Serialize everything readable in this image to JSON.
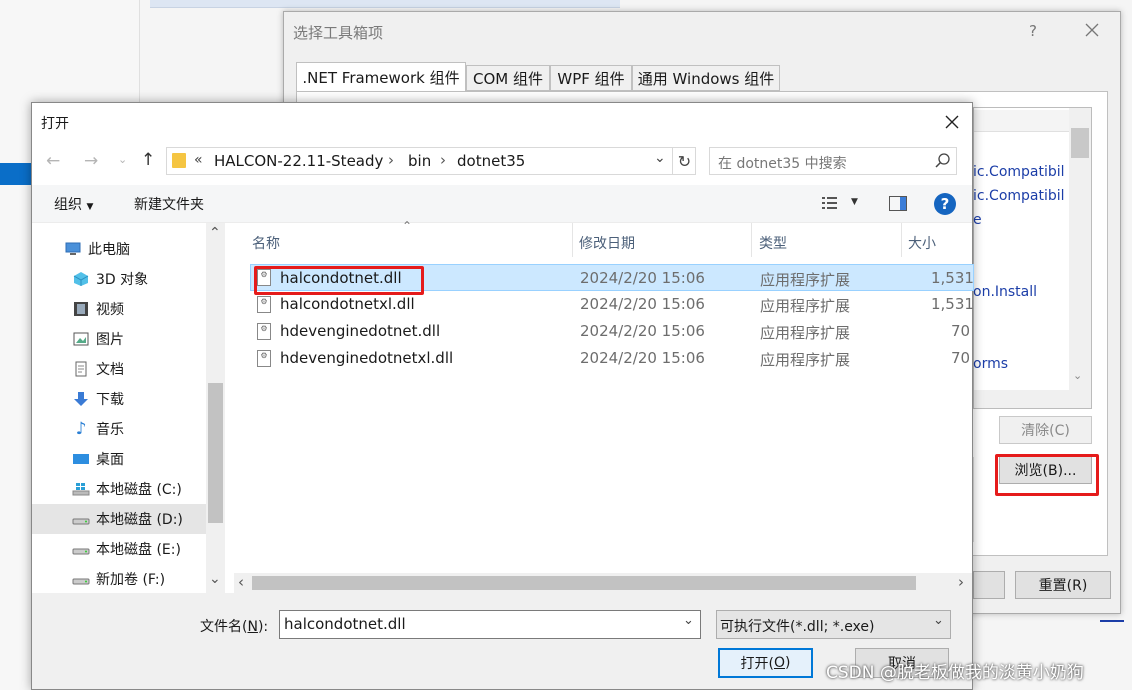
{
  "toolbox_dialog": {
    "title": "选择工具箱项",
    "help": "?",
    "tabs": [
      ".NET Framework 组件",
      "COM 组件",
      "WPF 组件",
      "通用 Windows 组件"
    ],
    "list_items": [
      "ic.Compatibil",
      "ic.Compatibil",
      "e",
      "on.Install",
      "orms"
    ],
    "clear_button": "清除(C)",
    "browse_button": "浏览(B)...",
    "reset_button": "重置(R)"
  },
  "open_dialog": {
    "title": "打开",
    "breadcrumb": [
      "HALCON-22.11-Steady",
      "bin",
      "dotnet35"
    ],
    "breadcrumb_prefix": "«",
    "search_placeholder": "在 dotnet35 中搜索",
    "organize": "组织",
    "new_folder": "新建文件夹",
    "tree": [
      {
        "label": "此电脑",
        "icon": "computer-icon"
      },
      {
        "label": "3D 对象",
        "icon": "cube-icon"
      },
      {
        "label": "视频",
        "icon": "film-icon"
      },
      {
        "label": "图片",
        "icon": "picture-icon"
      },
      {
        "label": "文档",
        "icon": "document-icon"
      },
      {
        "label": "下载",
        "icon": "download-icon"
      },
      {
        "label": "音乐",
        "icon": "music-icon"
      },
      {
        "label": "桌面",
        "icon": "desktop-icon"
      },
      {
        "label": "本地磁盘 (C:)",
        "icon": "system-drive-icon"
      },
      {
        "label": "本地磁盘 (D:)",
        "icon": "drive-icon"
      },
      {
        "label": "本地磁盘 (E:)",
        "icon": "drive-icon"
      },
      {
        "label": "新加卷 (F:)",
        "icon": "drive-icon"
      }
    ],
    "columns": {
      "name": "名称",
      "date": "修改日期",
      "type": "类型",
      "size": "大小"
    },
    "files": [
      {
        "name": "halcondotnet.dll",
        "date": "2024/2/20 15:06",
        "type": "应用程序扩展",
        "size": "1,531"
      },
      {
        "name": "halcondotnetxl.dll",
        "date": "2024/2/20 15:06",
        "type": "应用程序扩展",
        "size": "1,531"
      },
      {
        "name": "hdevenginedotnet.dll",
        "date": "2024/2/20 15:06",
        "type": "应用程序扩展",
        "size": "70"
      },
      {
        "name": "hdevenginedotnetxl.dll",
        "date": "2024/2/20 15:06",
        "type": "应用程序扩展",
        "size": "70"
      }
    ],
    "filename_label": "文件名(N):",
    "filename_label_pre": "文件名(",
    "filename_label_key": "N",
    "filename_label_post": "):",
    "filename_value": "halcondotnet.dll",
    "filter_value": "可执行文件(*.dll; *.exe)",
    "open_button_pre": "打开(",
    "open_button_key": "O",
    "open_button_post": ")",
    "cancel_button": "取消"
  },
  "watermark": "CSDN @脱老板做我的淡黄小奶狗"
}
